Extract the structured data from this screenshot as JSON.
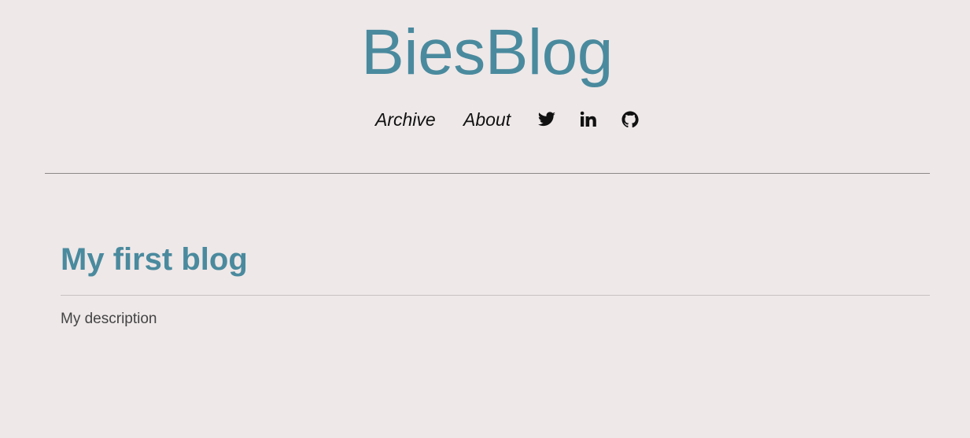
{
  "site": {
    "title": "BiesBlog"
  },
  "nav": {
    "archive_label": "Archive",
    "about_label": "About",
    "icons": [
      "twitter-icon",
      "linkedin-icon",
      "github-icon"
    ]
  },
  "post": {
    "title": "My first blog",
    "description": "My description"
  },
  "colors": {
    "background": "#EEE8E8",
    "accent": "#4A8A9E",
    "text": "#111111",
    "muted_text": "#444444"
  }
}
